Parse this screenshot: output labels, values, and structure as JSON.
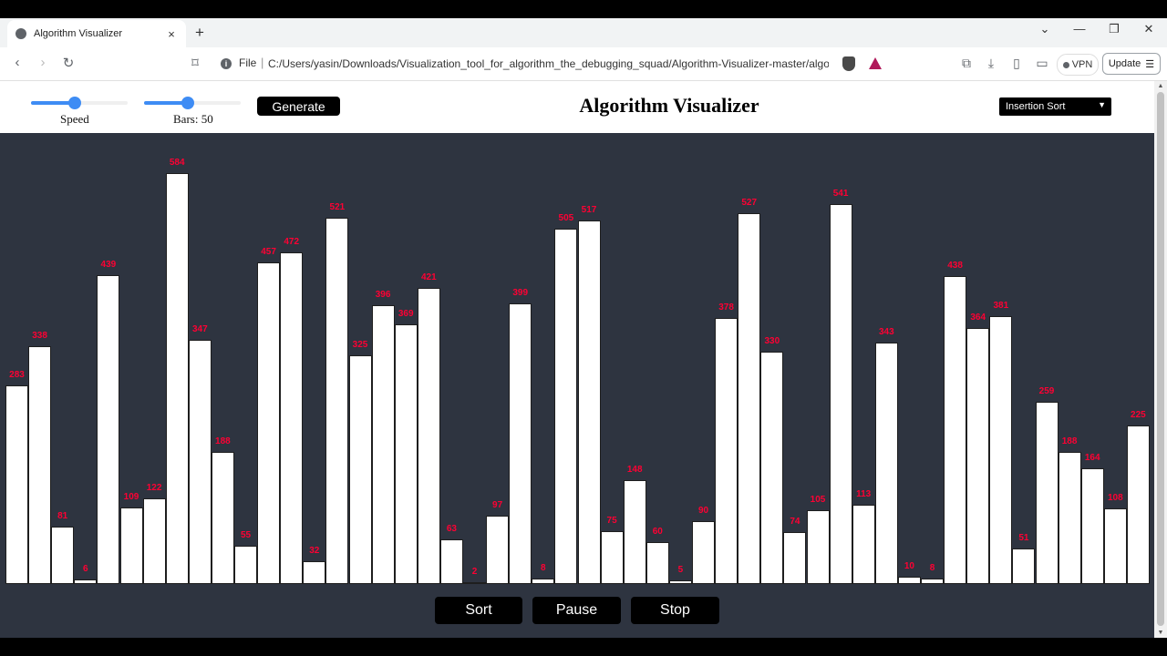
{
  "browser": {
    "tab_title": "Algorithm Visualizer",
    "tab_close": "×",
    "new_tab": "+",
    "address_scheme": "File",
    "address_url": "C:/Users/yasin/Downloads/Visualization_tool_for_algorithm_the_debugging_squad/Algorithm-Visualizer-master/algos...",
    "vpn_label": "VPN",
    "update_label": "Update",
    "icons": [
      "back-icon",
      "forward-icon",
      "reload-icon",
      "bookmark-icon",
      "info-icon",
      "brave-shield-icon",
      "brave-rewards-icon",
      "extensions-icon",
      "download-icon",
      "sidebar-icon",
      "wallet-icon",
      "menu-icon"
    ]
  },
  "controls": {
    "speed_label": "Speed",
    "speed_value": 0.45,
    "bars_label": "Bars: 50",
    "bars_value": 0.45,
    "generate_label": "Generate",
    "title": "Algorithm Visualizer",
    "algorithm_selected": "Insertion Sort"
  },
  "buttons": {
    "sort": "Sort",
    "pause": "Pause",
    "stop": "Stop"
  },
  "colors": {
    "canvas_bg": "#2e3440",
    "bar_fill": "#ffffff",
    "bar_label": "#ff0033",
    "slider_accent": "#3e8cf4"
  },
  "chart_data": {
    "type": "bar",
    "max_value": 600,
    "values": [
      283,
      338,
      81,
      6,
      439,
      109,
      122,
      584,
      347,
      188,
      55,
      457,
      472,
      32,
      521,
      325,
      396,
      369,
      421,
      63,
      2,
      97,
      399,
      8,
      505,
      517,
      75,
      148,
      60,
      5,
      90,
      378,
      527,
      330,
      74,
      105,
      541,
      113,
      343,
      10,
      8,
      438,
      364,
      381,
      51,
      259,
      188,
      164,
      108,
      225
    ]
  }
}
